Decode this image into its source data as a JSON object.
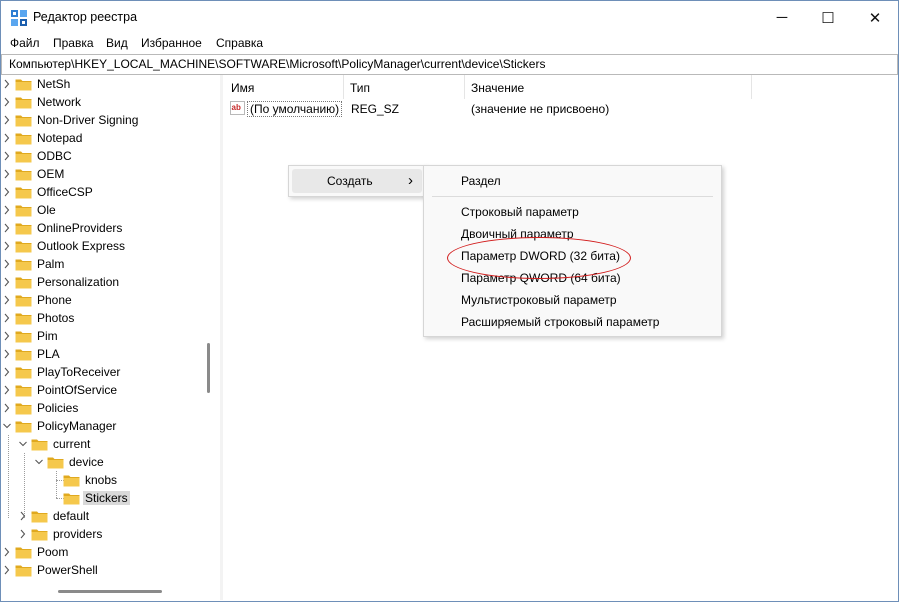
{
  "window": {
    "title": "Редактор реестра",
    "controls": {
      "minimize": "─",
      "maximize": "☐",
      "close": "✕"
    }
  },
  "menu": [
    "Файл",
    "Правка",
    "Вид",
    "Избранное",
    "Справка"
  ],
  "address": "Компьютер\\HKEY_LOCAL_MACHINE\\SOFTWARE\\Microsoft\\PolicyManager\\current\\device\\Stickers",
  "tree": {
    "items": [
      {
        "label": "NetSh",
        "level": 0,
        "chevron": "right"
      },
      {
        "label": "Network",
        "level": 0,
        "chevron": "right"
      },
      {
        "label": "Non-Driver Signing",
        "level": 0,
        "chevron": "right"
      },
      {
        "label": "Notepad",
        "level": 0,
        "chevron": "right"
      },
      {
        "label": "ODBC",
        "level": 0,
        "chevron": "right"
      },
      {
        "label": "OEM",
        "level": 0,
        "chevron": "right"
      },
      {
        "label": "OfficeCSP",
        "level": 0,
        "chevron": "right"
      },
      {
        "label": "Ole",
        "level": 0,
        "chevron": "right"
      },
      {
        "label": "OnlineProviders",
        "level": 0,
        "chevron": "right"
      },
      {
        "label": "Outlook Express",
        "level": 0,
        "chevron": "right"
      },
      {
        "label": "Palm",
        "level": 0,
        "chevron": "right"
      },
      {
        "label": "Personalization",
        "level": 0,
        "chevron": "right"
      },
      {
        "label": "Phone",
        "level": 0,
        "chevron": "right"
      },
      {
        "label": "Photos",
        "level": 0,
        "chevron": "right"
      },
      {
        "label": "Pim",
        "level": 0,
        "chevron": "right"
      },
      {
        "label": "PLA",
        "level": 0,
        "chevron": "right"
      },
      {
        "label": "PlayToReceiver",
        "level": 0,
        "chevron": "right"
      },
      {
        "label": "PointOfService",
        "level": 0,
        "chevron": "right"
      },
      {
        "label": "Policies",
        "level": 0,
        "chevron": "right"
      },
      {
        "label": "PolicyManager",
        "level": 0,
        "chevron": "down"
      },
      {
        "label": "current",
        "level": 1,
        "chevron": "down"
      },
      {
        "label": "device",
        "level": 2,
        "chevron": "down"
      },
      {
        "label": "knobs",
        "level": 3,
        "chevron": "none"
      },
      {
        "label": "Stickers",
        "level": 3,
        "chevron": "none",
        "selected": true
      },
      {
        "label": "default",
        "level": 1,
        "chevron": "right"
      },
      {
        "label": "providers",
        "level": 1,
        "chevron": "right"
      },
      {
        "label": "Poom",
        "level": 0,
        "chevron": "right"
      },
      {
        "label": "PowerShell",
        "level": 0,
        "chevron": "right"
      }
    ]
  },
  "list": {
    "columns": [
      "Имя",
      "Тип",
      "Значение"
    ],
    "rows": [
      {
        "icon": "ab",
        "name": "(По умолчанию)",
        "type": "REG_SZ",
        "value": "(значение не присвоено)"
      }
    ]
  },
  "context_menu": {
    "create_label": "Создать",
    "arrow": "›"
  },
  "submenu": {
    "key": "Раздел",
    "items": [
      "Строковый параметр",
      "Двоичный параметр",
      "Параметр DWORD (32 бита)",
      "Параметр QWORD (64 бита)",
      "Мультистроковый параметр",
      "Расширяемый строковый параметр"
    ],
    "highlighted_index": 2
  },
  "colors": {
    "folder": "#f5c84c",
    "folder_dark": "#e0a91f",
    "highlight_ring": "#d21c1c",
    "selection": "#d9d9d9"
  }
}
